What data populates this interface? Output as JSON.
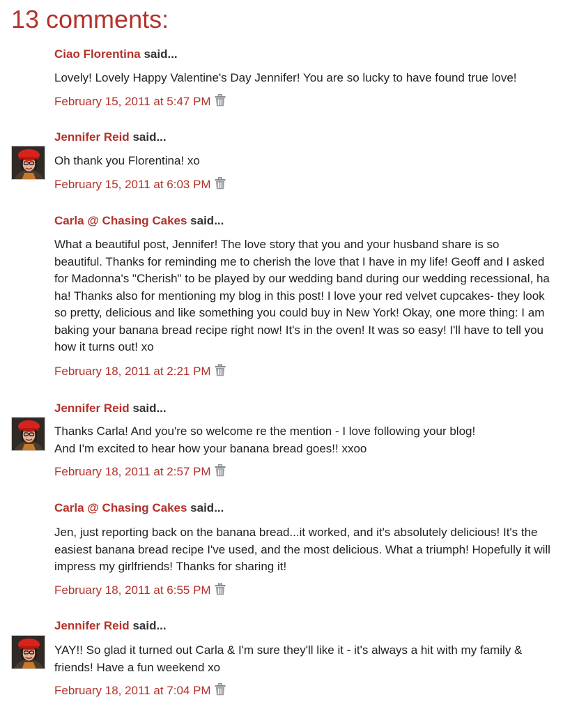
{
  "heading": "13 comments:",
  "said_label": "said...",
  "comments": [
    {
      "author": "Ciao Florentina",
      "body": "Lovely! Lovely Happy Valentine's Day Jennifer! You are so lucky to have found true love!",
      "timestamp": "February 15, 2011 at 5:47 PM",
      "has_avatar": false
    },
    {
      "author": "Jennifer Reid",
      "body": "Oh thank you Florentina! xo",
      "timestamp": "February 15, 2011 at 6:03 PM",
      "has_avatar": true
    },
    {
      "author": "Carla @ Chasing Cakes",
      "body": "What a beautiful post, Jennifer! The love story that you and your husband share is so beautiful. Thanks for reminding me to cherish the love that I have in my life! Geoff and I asked for Madonna's \"Cherish\" to be played by our wedding band during our wedding recessional, ha ha! Thanks also for mentioning my blog in this post! I love your red velvet cupcakes- they look so pretty, delicious and like something you could buy in New York! Okay, one more thing: I am baking your banana bread recipe right now! It's in the oven! It was so easy! I'll have to tell you how it turns out! xo",
      "timestamp": "February 18, 2011 at 2:21 PM",
      "has_avatar": false
    },
    {
      "author": "Jennifer Reid",
      "body": "Thanks Carla! And you're so welcome re the mention - I love following your blog!\nAnd I'm excited to hear how your banana bread goes!! xxoo",
      "timestamp": "February 18, 2011 at 2:57 PM",
      "has_avatar": true
    },
    {
      "author": "Carla @ Chasing Cakes",
      "body": "Jen, just reporting back on the banana bread...it worked, and it's absolutely delicious! It's the easiest banana bread recipe I've used, and the most delicious. What a triumph! Hopefully it will impress my girlfriends! Thanks for sharing it!",
      "timestamp": "February 18, 2011 at 6:55 PM",
      "has_avatar": false
    },
    {
      "author": "Jennifer Reid",
      "body": "YAY!! So glad it turned out Carla & I'm sure they'll like it - it's always a hit with my family & friends! Have a fun weekend xo",
      "timestamp": "February 18, 2011 at 7:04 PM",
      "has_avatar": true
    }
  ],
  "icons": {
    "delete": "trash-icon",
    "avatar": "avatar-photo"
  },
  "colors": {
    "accent": "#b3322b",
    "text": "#222222",
    "icon": "#8a8a8a"
  }
}
